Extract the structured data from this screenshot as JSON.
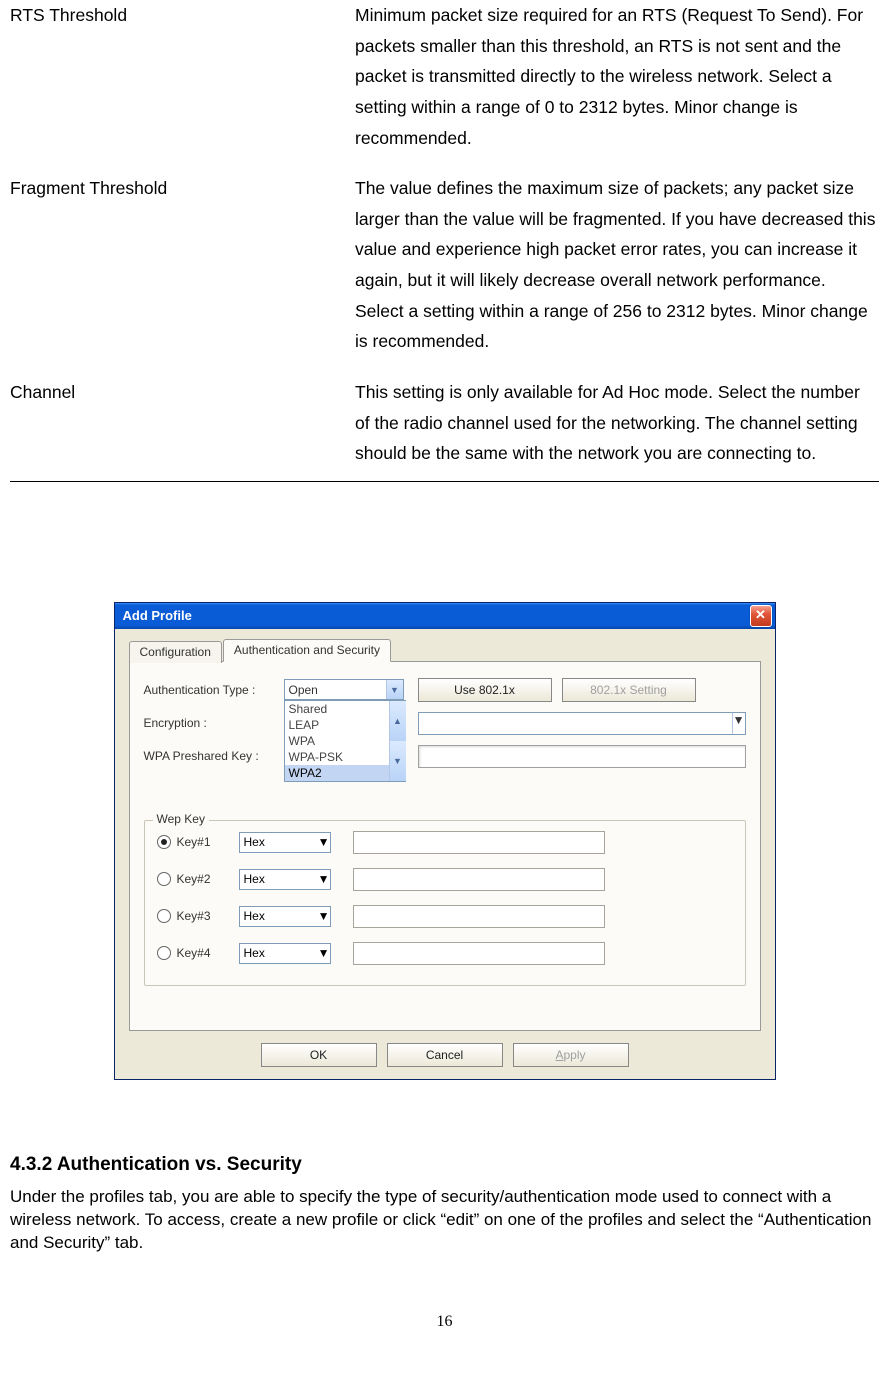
{
  "defs": [
    {
      "term": "RTS Threshold",
      "desc": "Minimum packet size required for an RTS (Request To Send). For packets smaller than this threshold, an RTS is not sent and the packet is transmitted directly to the wireless network. Select a setting within a range of 0 to 2312 bytes. Minor change is recommended."
    },
    {
      "term": "Fragment Threshold",
      "desc": "The value defines the maximum size of packets; any packet size larger than the value will be fragmented. If you have decreased this value and experience high packet error rates, you can increase it again, but it will likely decrease overall network performance. Select a setting within a range of 256 to 2312 bytes. Minor change is recommended."
    },
    {
      "term": "Channel",
      "desc": "This setting is only available for Ad Hoc mode. Select the number of the radio channel used for the networking. The channel setting should be the same with the network you are connecting to."
    }
  ],
  "dialog": {
    "title": "Add Profile",
    "tabs": {
      "config": "Configuration",
      "auth": "Authentication and Security"
    },
    "labels": {
      "authType": "Authentication Type :",
      "encryption": "Encryption :",
      "wpaKey": "WPA Preshared Key :",
      "wepGroup": "Wep Key"
    },
    "authCombo": "Open",
    "authList": {
      "i0": "Shared",
      "i1": "LEAP",
      "i2": "WPA",
      "i3": "WPA-PSK",
      "i4": "WPA2"
    },
    "buttons": {
      "use8021x": "Use 802.1x",
      "setting8021x": "802.1x Setting",
      "ok": "OK",
      "cancel": "Cancel",
      "apply_pre": "A",
      "apply_post": "pply"
    },
    "keys": [
      {
        "label": "Key#1",
        "fmt": "Hex",
        "selected": true
      },
      {
        "label": "Key#2",
        "fmt": "Hex",
        "selected": false
      },
      {
        "label": "Key#3",
        "fmt": "Hex",
        "selected": false
      },
      {
        "label": "Key#4",
        "fmt": "Hex",
        "selected": false
      }
    ]
  },
  "section": {
    "heading": "4.3.2   Authentication vs. Security",
    "body": "Under the profiles tab, you are able to specify the type of security/authentication mode used to connect with a wireless network.    To access, create a new profile or click “edit” on one of the profiles and select the “Authentication and Security” tab."
  },
  "pageNumber": "16"
}
